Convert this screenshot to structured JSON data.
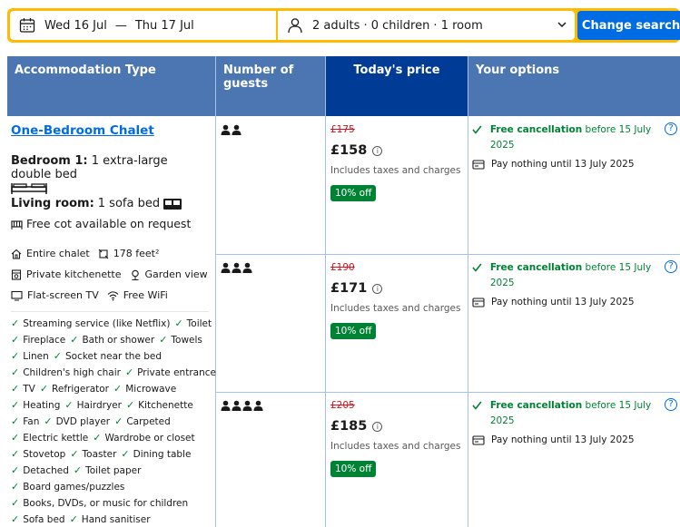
{
  "search": {
    "check_in": "Wed 16 Jul",
    "separator": "—",
    "check_out": "Thu 17 Jul",
    "guests": "2 adults · 0 children · 1 room",
    "button": "Change search"
  },
  "table": {
    "headers": {
      "type": "Accommodation Type",
      "guests": "Number of guests",
      "price": "Today's price",
      "options": "Your options"
    }
  },
  "room": {
    "name": "One-Bedroom Chalet",
    "bedroom_label": "Bedroom 1:",
    "bedroom_value": "1 extra-large double bed",
    "living_label": "Living room:",
    "living_value": "1 sofa bed",
    "cot": "Free cot available on request",
    "facts": [
      "Entire chalet",
      "178 feet²",
      "Private kitchenette",
      "Garden view",
      "Flat-screen TV",
      "Free WiFi"
    ],
    "amenities": [
      [
        "Streaming service (like Netflix)",
        "Toilet"
      ],
      [
        "Fireplace",
        "Bath or shower",
        "Towels"
      ],
      [
        "Linen",
        "Socket near the bed"
      ],
      [
        "Children's high chair",
        "Private entrance"
      ],
      [
        "TV",
        "Refrigerator",
        "Microwave"
      ],
      [
        "Heating",
        "Hairdryer",
        "Kitchenette"
      ],
      [
        "Fan",
        "DVD player",
        "Carpeted"
      ],
      [
        "Electric kettle",
        "Wardrobe or closet"
      ],
      [
        "Stovetop",
        "Toaster",
        "Dining table"
      ],
      [
        "Detached",
        "Toilet paper"
      ],
      [
        "Board games/puzzles"
      ],
      [
        "Books, DVDs, or music for children"
      ],
      [
        "Sofa bed",
        "Hand sanitiser"
      ]
    ]
  },
  "options": [
    {
      "guests": 2,
      "old_price": "£175",
      "price": "£158",
      "taxes": "Includes taxes and charges",
      "badge": "10% off",
      "cancel_bold": "Free cancellation",
      "cancel_rest": "before 15 July 2025",
      "pay": "Pay nothing until 13 July 2025"
    },
    {
      "guests": 3,
      "old_price": "£190",
      "price": "£171",
      "taxes": "Includes taxes and charges",
      "badge": "10% off",
      "cancel_bold": "Free cancellation",
      "cancel_rest": "before 15 July 2025",
      "pay": "Pay nothing until 13 July 2025"
    },
    {
      "guests": 4,
      "old_price": "£205",
      "price": "£185",
      "taxes": "Includes taxes and charges",
      "badge": "10% off",
      "cancel_bold": "Free cancellation",
      "cancel_rest": "before 15 July 2025",
      "pay": "Pay nothing until 13 July 2025"
    }
  ],
  "colors": {
    "search_border": "#febb02",
    "primary_blue": "#006ce4",
    "header_blue": "#4c76b2",
    "price_header_blue": "#003b95",
    "green": "#008234",
    "strike_red": "#d4111e"
  }
}
